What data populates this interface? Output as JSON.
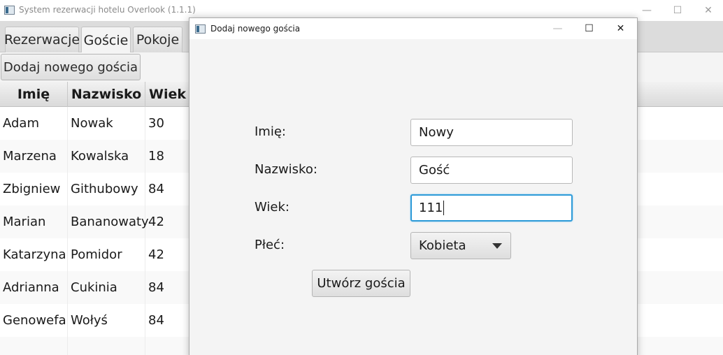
{
  "main_window": {
    "title": "System rezerwacji hotelu Overlook (1.1.1)",
    "controls": {
      "minimize": "—",
      "maximize": "☐",
      "close": "✕"
    }
  },
  "tabs": [
    {
      "label": "Rezerwacje"
    },
    {
      "label": "Goście",
      "active": true
    },
    {
      "label": "Pokoje"
    }
  ],
  "toolbar": {
    "add_guest_label": "Dodaj nowego gościa"
  },
  "table": {
    "columns": [
      "Imię",
      "Nazwisko",
      "Wiek"
    ],
    "rows": [
      [
        "Adam",
        "Nowak",
        "30"
      ],
      [
        "Marzena",
        "Kowalska",
        "18"
      ],
      [
        "Zbigniew",
        "Githubowy",
        "84"
      ],
      [
        "Marian",
        "Bananowaty",
        "42"
      ],
      [
        "Katarzyna",
        "Pomidor",
        "42"
      ],
      [
        "Adrianna",
        "Cukinia",
        "84"
      ],
      [
        "Genowefa",
        "Wołyś",
        "84"
      ]
    ]
  },
  "dialog": {
    "title": "Dodaj nowego gościa",
    "controls": {
      "minimize": "—",
      "maximize": "☐",
      "close": "✕"
    },
    "form": {
      "first_name_label": "Imię:",
      "first_name_value": "Nowy",
      "last_name_label": "Nazwisko:",
      "last_name_value": "Gość",
      "age_label": "Wiek:",
      "age_value": "111",
      "gender_label": "Płeć:",
      "gender_value": "Kobieta",
      "submit_label": "Utwórz gościa"
    }
  },
  "colors": {
    "focus_border": "#2e9bd8",
    "tabbar_background": "#dcdcdc",
    "dialog_background": "#f4f4f4"
  }
}
